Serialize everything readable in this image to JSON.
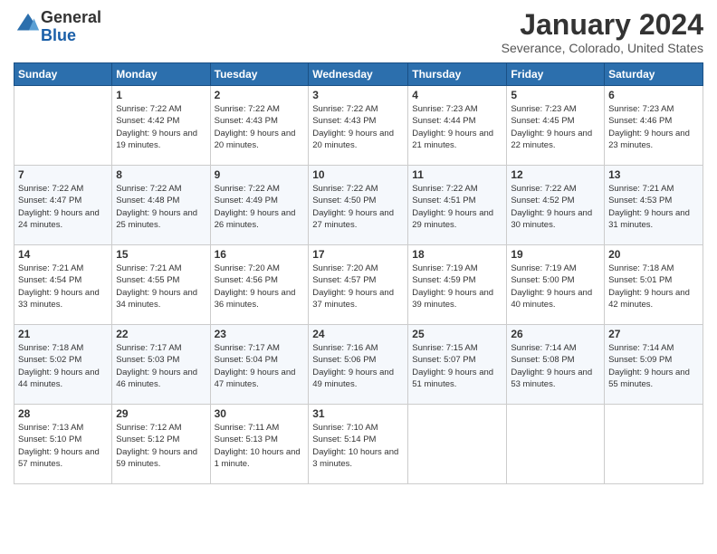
{
  "header": {
    "logo_general": "General",
    "logo_blue": "Blue",
    "month_title": "January 2024",
    "location": "Severance, Colorado, United States"
  },
  "days_of_week": [
    "Sunday",
    "Monday",
    "Tuesday",
    "Wednesday",
    "Thursday",
    "Friday",
    "Saturday"
  ],
  "weeks": [
    [
      {
        "day": "",
        "sunrise": "",
        "sunset": "",
        "daylight": ""
      },
      {
        "day": "1",
        "sunrise": "Sunrise: 7:22 AM",
        "sunset": "Sunset: 4:42 PM",
        "daylight": "Daylight: 9 hours and 19 minutes."
      },
      {
        "day": "2",
        "sunrise": "Sunrise: 7:22 AM",
        "sunset": "Sunset: 4:43 PM",
        "daylight": "Daylight: 9 hours and 20 minutes."
      },
      {
        "day": "3",
        "sunrise": "Sunrise: 7:22 AM",
        "sunset": "Sunset: 4:43 PM",
        "daylight": "Daylight: 9 hours and 20 minutes."
      },
      {
        "day": "4",
        "sunrise": "Sunrise: 7:23 AM",
        "sunset": "Sunset: 4:44 PM",
        "daylight": "Daylight: 9 hours and 21 minutes."
      },
      {
        "day": "5",
        "sunrise": "Sunrise: 7:23 AM",
        "sunset": "Sunset: 4:45 PM",
        "daylight": "Daylight: 9 hours and 22 minutes."
      },
      {
        "day": "6",
        "sunrise": "Sunrise: 7:23 AM",
        "sunset": "Sunset: 4:46 PM",
        "daylight": "Daylight: 9 hours and 23 minutes."
      }
    ],
    [
      {
        "day": "7",
        "sunrise": "Sunrise: 7:22 AM",
        "sunset": "Sunset: 4:47 PM",
        "daylight": "Daylight: 9 hours and 24 minutes."
      },
      {
        "day": "8",
        "sunrise": "Sunrise: 7:22 AM",
        "sunset": "Sunset: 4:48 PM",
        "daylight": "Daylight: 9 hours and 25 minutes."
      },
      {
        "day": "9",
        "sunrise": "Sunrise: 7:22 AM",
        "sunset": "Sunset: 4:49 PM",
        "daylight": "Daylight: 9 hours and 26 minutes."
      },
      {
        "day": "10",
        "sunrise": "Sunrise: 7:22 AM",
        "sunset": "Sunset: 4:50 PM",
        "daylight": "Daylight: 9 hours and 27 minutes."
      },
      {
        "day": "11",
        "sunrise": "Sunrise: 7:22 AM",
        "sunset": "Sunset: 4:51 PM",
        "daylight": "Daylight: 9 hours and 29 minutes."
      },
      {
        "day": "12",
        "sunrise": "Sunrise: 7:22 AM",
        "sunset": "Sunset: 4:52 PM",
        "daylight": "Daylight: 9 hours and 30 minutes."
      },
      {
        "day": "13",
        "sunrise": "Sunrise: 7:21 AM",
        "sunset": "Sunset: 4:53 PM",
        "daylight": "Daylight: 9 hours and 31 minutes."
      }
    ],
    [
      {
        "day": "14",
        "sunrise": "Sunrise: 7:21 AM",
        "sunset": "Sunset: 4:54 PM",
        "daylight": "Daylight: 9 hours and 33 minutes."
      },
      {
        "day": "15",
        "sunrise": "Sunrise: 7:21 AM",
        "sunset": "Sunset: 4:55 PM",
        "daylight": "Daylight: 9 hours and 34 minutes."
      },
      {
        "day": "16",
        "sunrise": "Sunrise: 7:20 AM",
        "sunset": "Sunset: 4:56 PM",
        "daylight": "Daylight: 9 hours and 36 minutes."
      },
      {
        "day": "17",
        "sunrise": "Sunrise: 7:20 AM",
        "sunset": "Sunset: 4:57 PM",
        "daylight": "Daylight: 9 hours and 37 minutes."
      },
      {
        "day": "18",
        "sunrise": "Sunrise: 7:19 AM",
        "sunset": "Sunset: 4:59 PM",
        "daylight": "Daylight: 9 hours and 39 minutes."
      },
      {
        "day": "19",
        "sunrise": "Sunrise: 7:19 AM",
        "sunset": "Sunset: 5:00 PM",
        "daylight": "Daylight: 9 hours and 40 minutes."
      },
      {
        "day": "20",
        "sunrise": "Sunrise: 7:18 AM",
        "sunset": "Sunset: 5:01 PM",
        "daylight": "Daylight: 9 hours and 42 minutes."
      }
    ],
    [
      {
        "day": "21",
        "sunrise": "Sunrise: 7:18 AM",
        "sunset": "Sunset: 5:02 PM",
        "daylight": "Daylight: 9 hours and 44 minutes."
      },
      {
        "day": "22",
        "sunrise": "Sunrise: 7:17 AM",
        "sunset": "Sunset: 5:03 PM",
        "daylight": "Daylight: 9 hours and 46 minutes."
      },
      {
        "day": "23",
        "sunrise": "Sunrise: 7:17 AM",
        "sunset": "Sunset: 5:04 PM",
        "daylight": "Daylight: 9 hours and 47 minutes."
      },
      {
        "day": "24",
        "sunrise": "Sunrise: 7:16 AM",
        "sunset": "Sunset: 5:06 PM",
        "daylight": "Daylight: 9 hours and 49 minutes."
      },
      {
        "day": "25",
        "sunrise": "Sunrise: 7:15 AM",
        "sunset": "Sunset: 5:07 PM",
        "daylight": "Daylight: 9 hours and 51 minutes."
      },
      {
        "day": "26",
        "sunrise": "Sunrise: 7:14 AM",
        "sunset": "Sunset: 5:08 PM",
        "daylight": "Daylight: 9 hours and 53 minutes."
      },
      {
        "day": "27",
        "sunrise": "Sunrise: 7:14 AM",
        "sunset": "Sunset: 5:09 PM",
        "daylight": "Daylight: 9 hours and 55 minutes."
      }
    ],
    [
      {
        "day": "28",
        "sunrise": "Sunrise: 7:13 AM",
        "sunset": "Sunset: 5:10 PM",
        "daylight": "Daylight: 9 hours and 57 minutes."
      },
      {
        "day": "29",
        "sunrise": "Sunrise: 7:12 AM",
        "sunset": "Sunset: 5:12 PM",
        "daylight": "Daylight: 9 hours and 59 minutes."
      },
      {
        "day": "30",
        "sunrise": "Sunrise: 7:11 AM",
        "sunset": "Sunset: 5:13 PM",
        "daylight": "Daylight: 10 hours and 1 minute."
      },
      {
        "day": "31",
        "sunrise": "Sunrise: 7:10 AM",
        "sunset": "Sunset: 5:14 PM",
        "daylight": "Daylight: 10 hours and 3 minutes."
      },
      {
        "day": "",
        "sunrise": "",
        "sunset": "",
        "daylight": ""
      },
      {
        "day": "",
        "sunrise": "",
        "sunset": "",
        "daylight": ""
      },
      {
        "day": "",
        "sunrise": "",
        "sunset": "",
        "daylight": ""
      }
    ]
  ]
}
